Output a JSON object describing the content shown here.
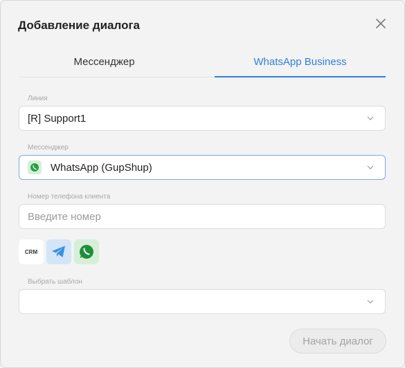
{
  "dialog": {
    "title": "Добавление диалога",
    "close_icon": "close-icon"
  },
  "tabs": [
    {
      "label": "Мессенджер",
      "active": false
    },
    {
      "label": "WhatsApp Business",
      "active": true
    }
  ],
  "line": {
    "label": "Линия",
    "value": "[R] Support1"
  },
  "messenger": {
    "label": "Мессенджер",
    "value": "WhatsApp (GupShup)",
    "icon": "whatsapp-icon"
  },
  "phone": {
    "label": "Номер телефона клиента",
    "placeholder": "Введите номер"
  },
  "quick_buttons": [
    {
      "name": "crm",
      "label": "CRM"
    },
    {
      "name": "telegram",
      "icon": "telegram-icon"
    },
    {
      "name": "whatsapp",
      "icon": "whatsapp-icon"
    }
  ],
  "template": {
    "label": "Выбрать шаблон",
    "value": ""
  },
  "start_button": {
    "label": "Начать диалог",
    "disabled": true
  },
  "colors": {
    "accent": "#2f7fe0",
    "whatsapp_green": "#25a244",
    "telegram_blue": "#3a8fe0"
  }
}
